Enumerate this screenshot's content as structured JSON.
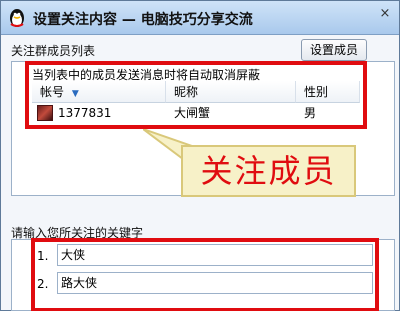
{
  "window": {
    "title": "设置关注内容 — 电脑技巧分享交流",
    "close_glyph": "×"
  },
  "members": {
    "section_label": "关注群成员列表",
    "set_button": "设置成员",
    "notice": "当列表中的成员发送消息时将自动取消屏蔽",
    "columns": [
      "帐号",
      "昵称",
      "性别"
    ],
    "sort_indicator": "▼",
    "rows": [
      {
        "account": "1377831",
        "nickname": "大闸蟹",
        "gender": "男"
      }
    ]
  },
  "callout": {
    "text": "关注成员"
  },
  "keywords": {
    "section_label": "请输入您所关注的关键字",
    "items": [
      {
        "index": "1.",
        "value": "大侠"
      },
      {
        "index": "2.",
        "value": "路大侠"
      }
    ]
  },
  "colors": {
    "highlight_red": "#e00c10",
    "callout_bg": "#f7f1c8",
    "titlebar": "#a9c9ec"
  }
}
